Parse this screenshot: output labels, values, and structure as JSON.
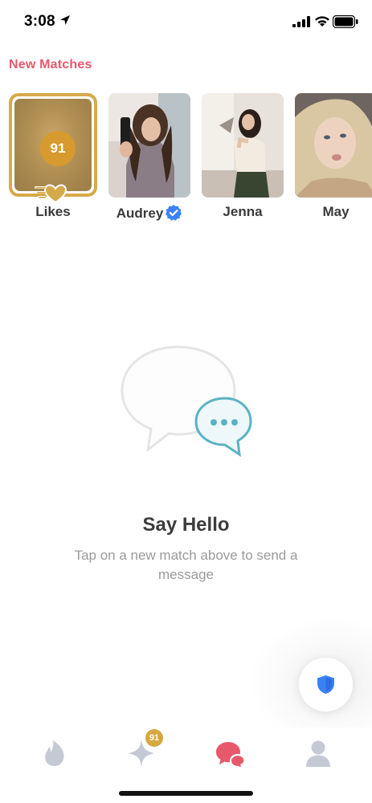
{
  "status_bar": {
    "time": "3:08"
  },
  "section_title": "New Matches",
  "likes": {
    "count": "91",
    "label": "Likes"
  },
  "matches": [
    {
      "name": "Audrey",
      "verified": true
    },
    {
      "name": "Jenna",
      "verified": false
    },
    {
      "name": "May",
      "verified": false
    }
  ],
  "empty_state": {
    "title": "Say Hello",
    "subtitle": "Tap on a new match above to send a message"
  },
  "tab_bar": {
    "tabs": [
      {
        "icon": "flame-icon"
      },
      {
        "icon": "sparkle-icon",
        "badge": "91"
      },
      {
        "icon": "chat-bubbles-icon",
        "active": true
      },
      {
        "icon": "profile-icon"
      }
    ]
  },
  "colors": {
    "brand": "#e8586b",
    "gold": "#d6a94a",
    "verified_blue": "#3b82f6",
    "teal": "#5ab3c4",
    "tab_inactive": "#c4c9d4"
  }
}
